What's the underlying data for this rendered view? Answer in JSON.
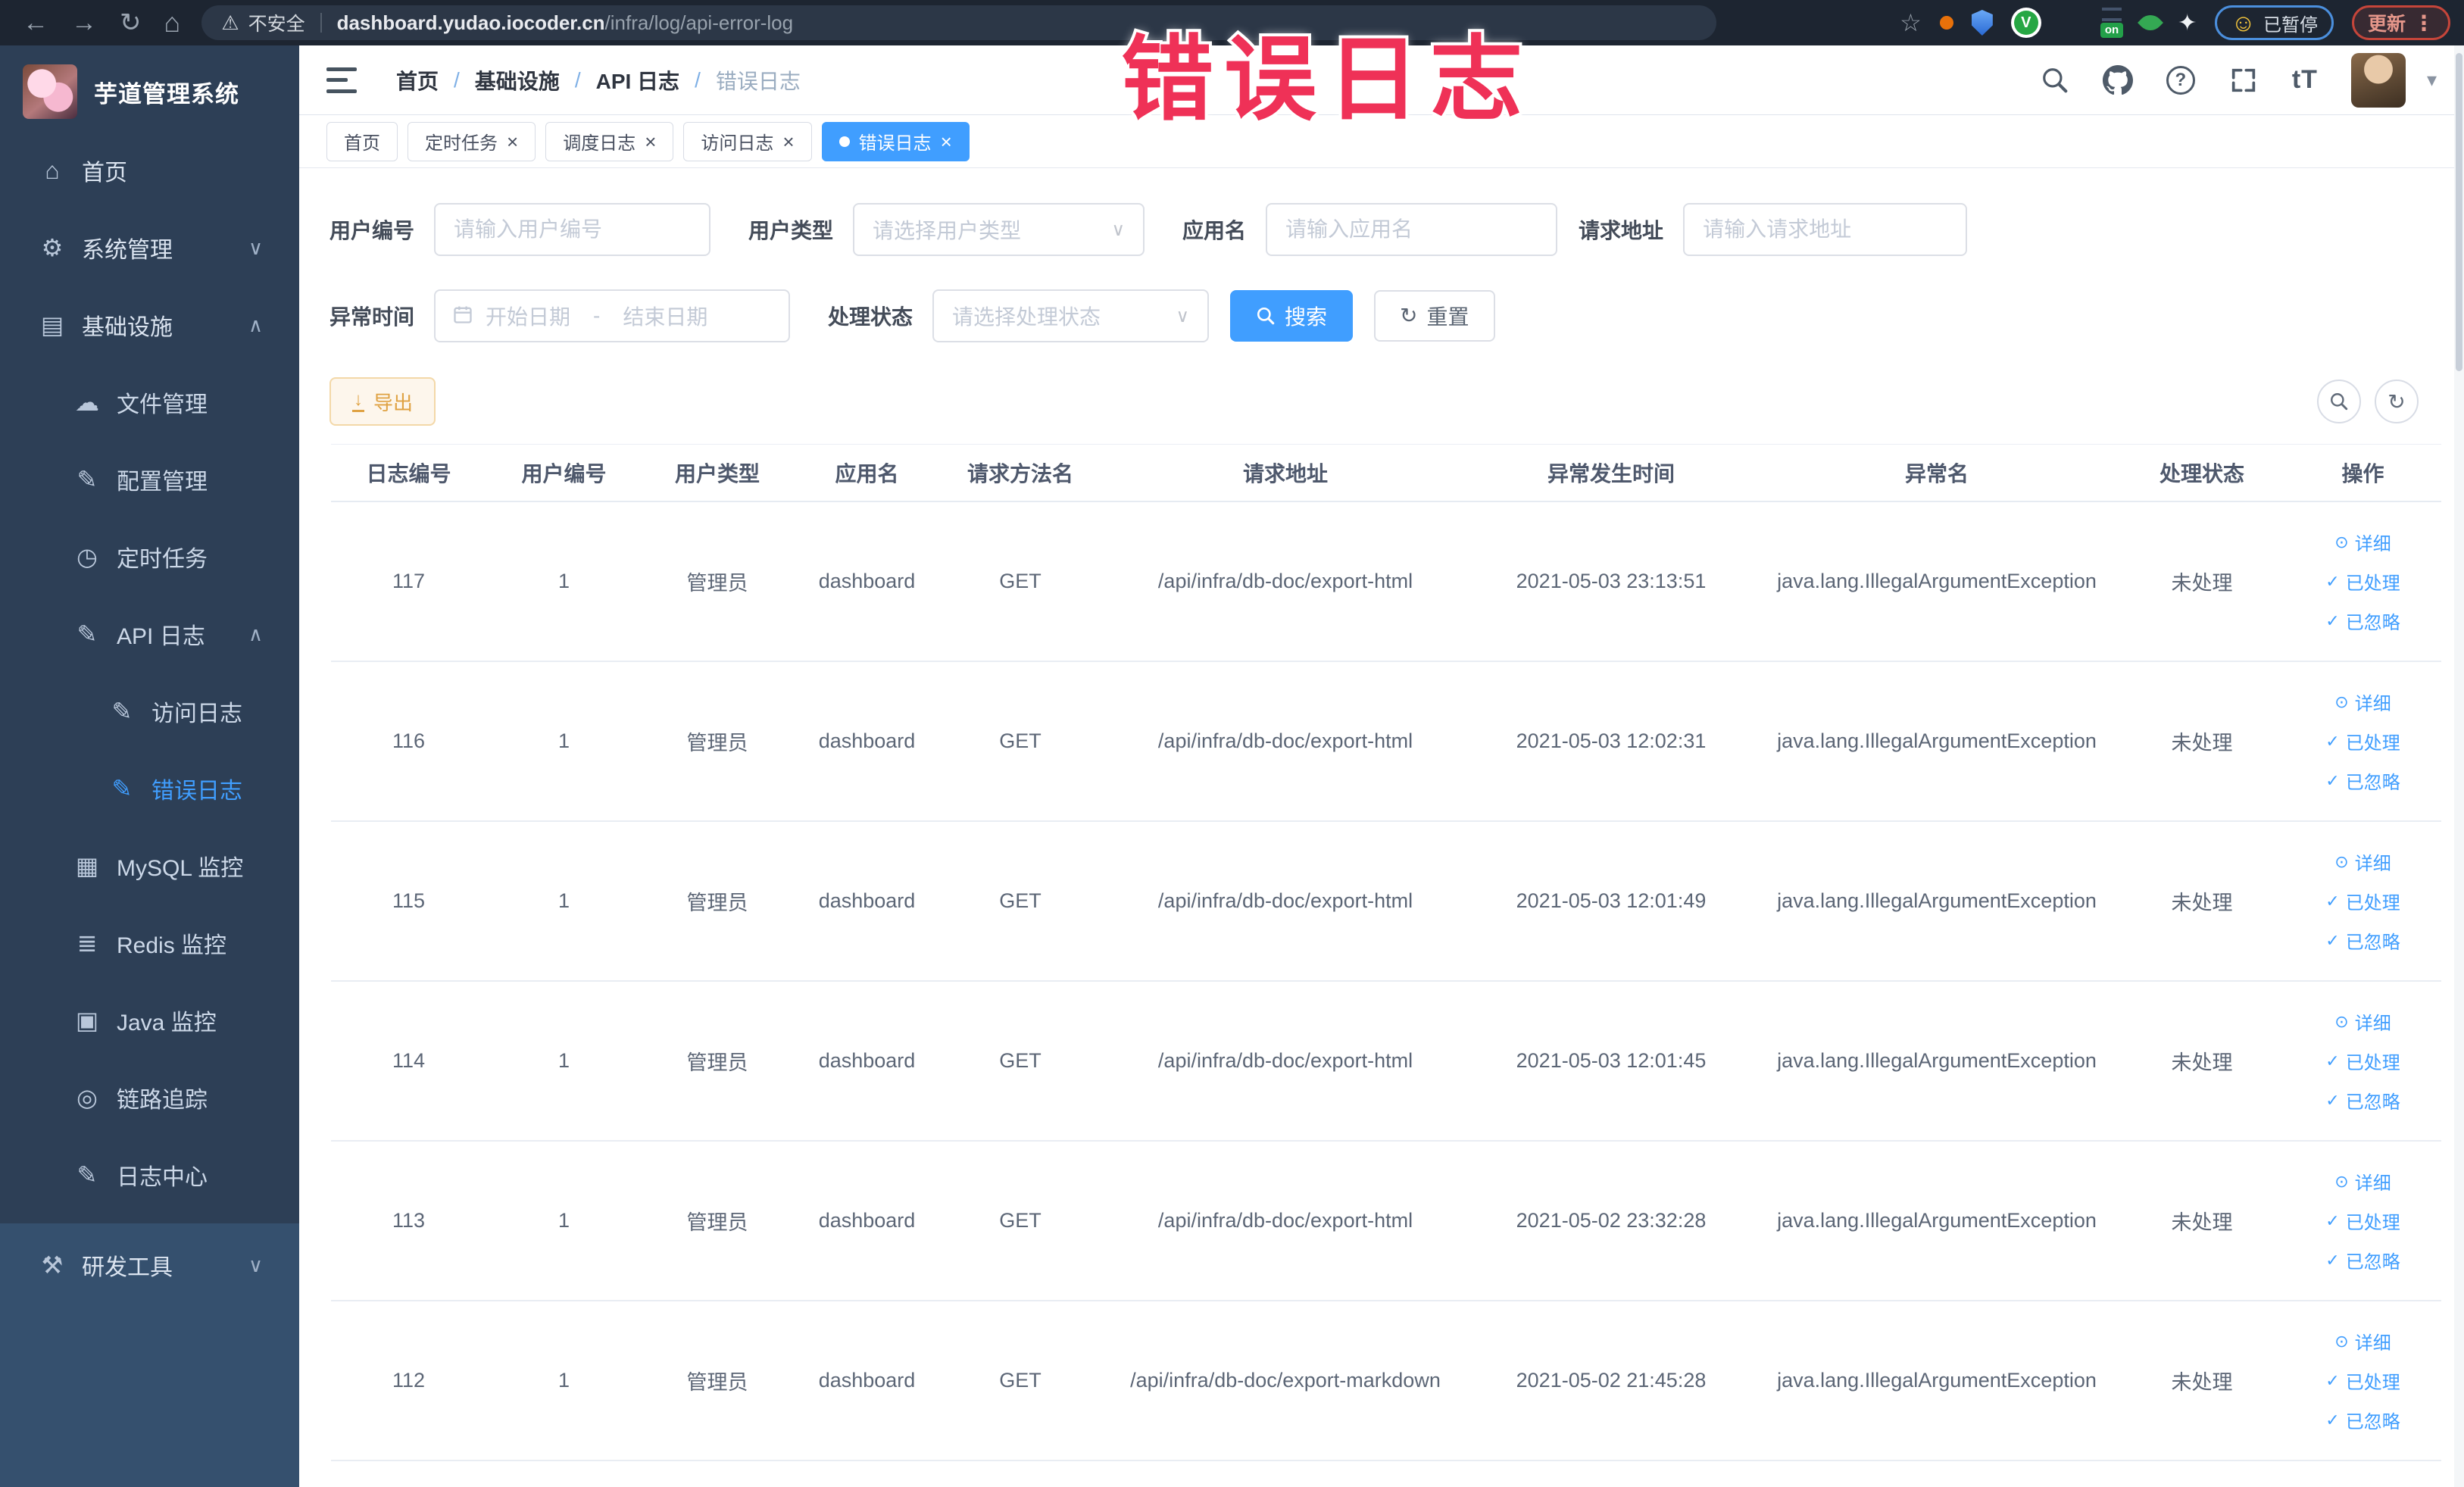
{
  "annotation": {
    "text": "错误日志"
  },
  "browser": {
    "security_label": "不安全",
    "url_domain": "dashboard.yudao.iocoder.cn",
    "url_path": "/infra/log/api-error-log",
    "paused_badge": "已暂停",
    "update_label": "更新",
    "ext_v": "V",
    "ext_on": "on"
  },
  "icons": {
    "back": "←",
    "forward": "→",
    "reload": "↻",
    "home": "⌂",
    "warning": "⚠",
    "star": "☆",
    "sparkle": "✦",
    "kebab": "⋮",
    "smiley": "☺",
    "chevron_up": "∧",
    "chevron_down": "∨",
    "caret_down": "▾",
    "question": "?",
    "font_size": "tT",
    "close": "×",
    "menu_home": "⌂",
    "gear": "⚙",
    "infra": "▤",
    "cloud": "☁",
    "edit": "✎",
    "timer": "◷",
    "grid": "▦",
    "stack": "≣",
    "monitor": "▣",
    "trace": "◎",
    "tools": "⚒",
    "view": "⊙",
    "check": "✓",
    "download": "↓",
    "refresh": "↻"
  },
  "sidebar": {
    "title": "芋道管理系统",
    "items": [
      {
        "label": "首页",
        "icon": "menu_home"
      },
      {
        "label": "系统管理",
        "icon": "gear",
        "chevron": "down"
      },
      {
        "label": "基础设施",
        "icon": "infra",
        "chevron": "up",
        "expanded": true
      },
      {
        "label": "文件管理",
        "icon": "cloud"
      },
      {
        "label": "配置管理",
        "icon": "edit"
      },
      {
        "label": "定时任务",
        "icon": "timer"
      },
      {
        "label": "API 日志",
        "icon": "edit",
        "chevron": "up",
        "expanded": true
      },
      {
        "label": "访问日志",
        "icon": "edit"
      },
      {
        "label": "错误日志",
        "icon": "edit",
        "active": true
      },
      {
        "label": "MySQL 监控",
        "icon": "grid"
      },
      {
        "label": "Redis 监控",
        "icon": "stack"
      },
      {
        "label": "Java 监控",
        "icon": "monitor"
      },
      {
        "label": "链路追踪",
        "icon": "trace"
      },
      {
        "label": "日志中心",
        "icon": "edit"
      },
      {
        "label": "研发工具",
        "icon": "tools",
        "chevron": "down"
      }
    ]
  },
  "header": {
    "breadcrumb": [
      "首页",
      "基础设施",
      "API 日志",
      "错误日志"
    ],
    "separator": "/"
  },
  "tabs": [
    {
      "label": "首页",
      "closable": false,
      "active": false
    },
    {
      "label": "定时任务",
      "closable": true,
      "active": false
    },
    {
      "label": "调度日志",
      "closable": true,
      "active": false
    },
    {
      "label": "访问日志",
      "closable": true,
      "active": false
    },
    {
      "label": "错误日志",
      "closable": true,
      "active": true
    }
  ],
  "filters": {
    "user_id": {
      "label": "用户编号",
      "placeholder": "请输入用户编号"
    },
    "user_type": {
      "label": "用户类型",
      "placeholder": "请选择用户类型"
    },
    "app_name": {
      "label": "应用名",
      "placeholder": "请输入应用名"
    },
    "request_url": {
      "label": "请求地址",
      "placeholder": "请输入请求地址"
    },
    "exception_time": {
      "label": "异常时间",
      "start_placeholder": "开始日期",
      "separator": "-",
      "end_placeholder": "结束日期"
    },
    "process_status": {
      "label": "处理状态",
      "placeholder": "请选择处理状态"
    },
    "search_label": "搜索",
    "reset_label": "重置"
  },
  "toolbar": {
    "export_label": "导出"
  },
  "table": {
    "columns": [
      "日志编号",
      "用户编号",
      "用户类型",
      "应用名",
      "请求方法名",
      "请求地址",
      "异常发生时间",
      "异常名",
      "处理状态",
      "操作"
    ],
    "row_actions": [
      "详细",
      "已处理",
      "已忽略"
    ],
    "rows": [
      {
        "id": "117",
        "user_id": "1",
        "user_type": "管理员",
        "app": "dashboard",
        "method": "GET",
        "url": "/api/infra/db-doc/export-html",
        "time": "2021-05-03 23:13:51",
        "exception": "java.lang.IllegalArgumentException",
        "status": "未处理"
      },
      {
        "id": "116",
        "user_id": "1",
        "user_type": "管理员",
        "app": "dashboard",
        "method": "GET",
        "url": "/api/infra/db-doc/export-html",
        "time": "2021-05-03 12:02:31",
        "exception": "java.lang.IllegalArgumentException",
        "status": "未处理"
      },
      {
        "id": "115",
        "user_id": "1",
        "user_type": "管理员",
        "app": "dashboard",
        "method": "GET",
        "url": "/api/infra/db-doc/export-html",
        "time": "2021-05-03 12:01:49",
        "exception": "java.lang.IllegalArgumentException",
        "status": "未处理"
      },
      {
        "id": "114",
        "user_id": "1",
        "user_type": "管理员",
        "app": "dashboard",
        "method": "GET",
        "url": "/api/infra/db-doc/export-html",
        "time": "2021-05-03 12:01:45",
        "exception": "java.lang.IllegalArgumentException",
        "status": "未处理"
      },
      {
        "id": "113",
        "user_id": "1",
        "user_type": "管理员",
        "app": "dashboard",
        "method": "GET",
        "url": "/api/infra/db-doc/export-html",
        "time": "2021-05-02 23:32:28",
        "exception": "java.lang.IllegalArgumentException",
        "status": "未处理"
      },
      {
        "id": "112",
        "user_id": "1",
        "user_type": "管理员",
        "app": "dashboard",
        "method": "GET",
        "url": "/api/infra/db-doc/export-markdown",
        "time": "2021-05-02 21:45:28",
        "exception": "java.lang.IllegalArgumentException",
        "status": "未处理"
      }
    ]
  }
}
